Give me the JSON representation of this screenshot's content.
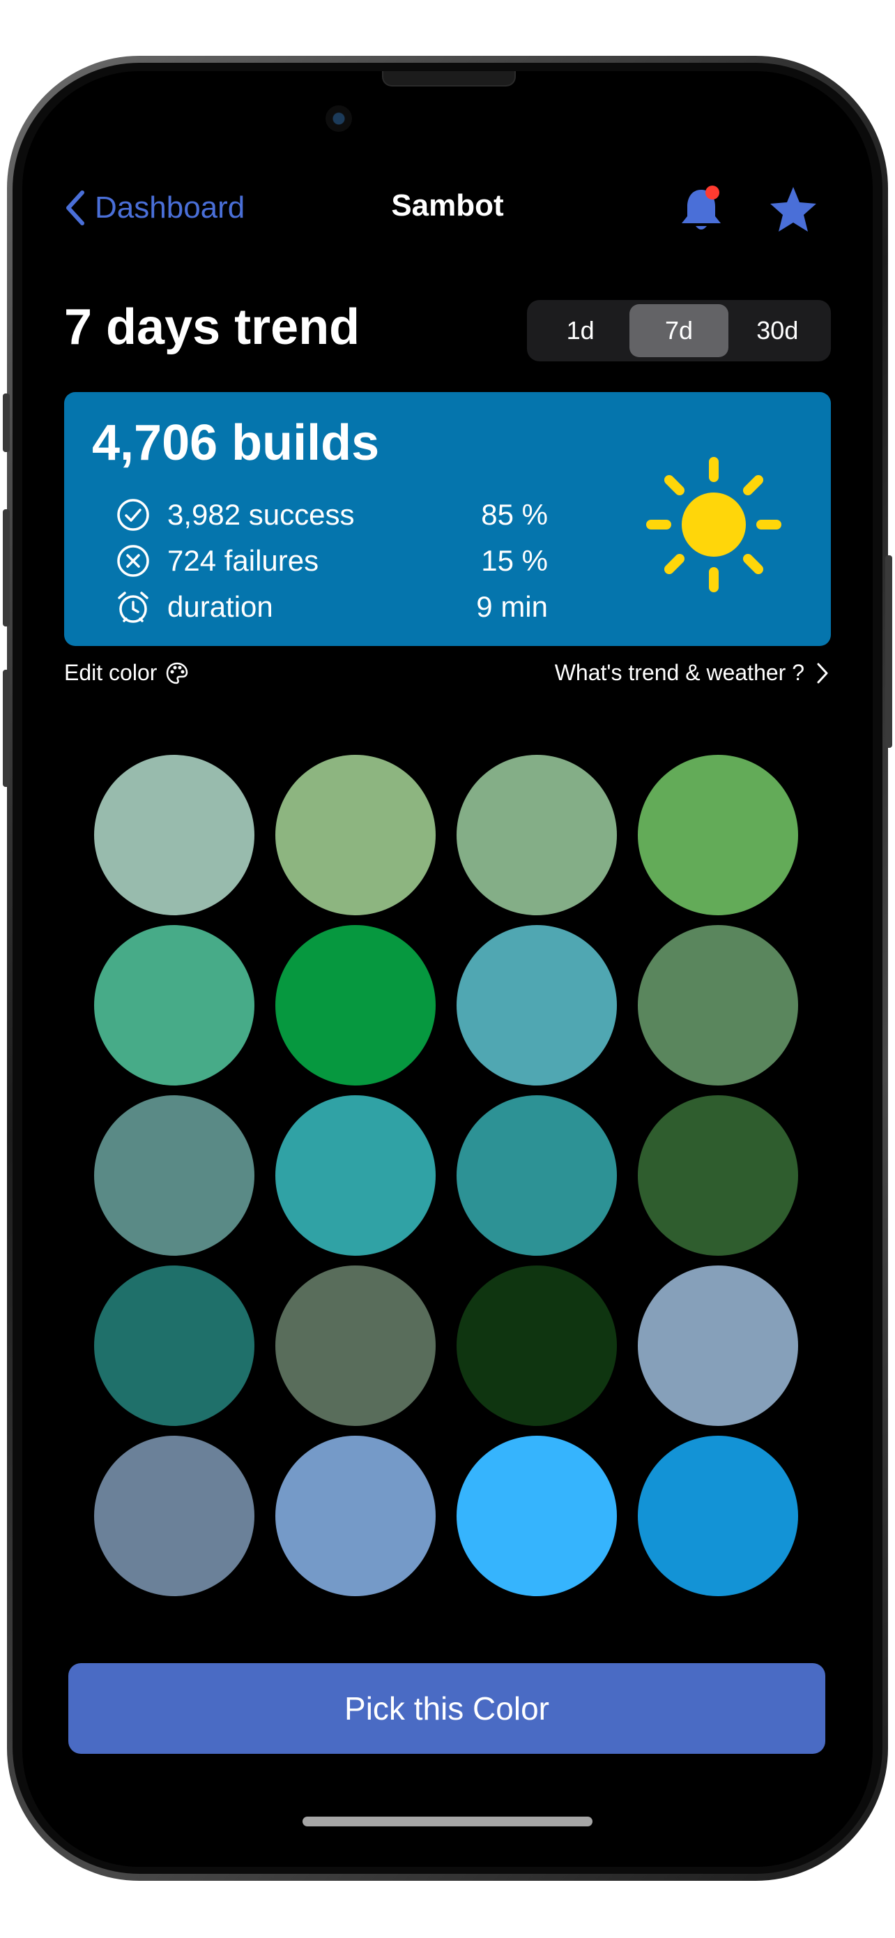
{
  "nav": {
    "back_label": "Dashboard",
    "title": "Sambot"
  },
  "trend": {
    "heading": "7 days trend",
    "periods": [
      "1d",
      "7d",
      "30d"
    ],
    "selected_period": "7d"
  },
  "summary": {
    "builds": "4,706 builds",
    "stats": [
      {
        "icon": "check-circle-icon",
        "label": "3,982 success",
        "value": "85 %"
      },
      {
        "icon": "x-circle-icon",
        "label": "724 failures",
        "value": "15 %"
      },
      {
        "icon": "alarm-clock-icon",
        "label": "duration",
        "value": "9 min"
      }
    ],
    "weather_icon": "sun-icon",
    "card_color": "#0575ad"
  },
  "links": {
    "edit_color": "Edit color",
    "trend_weather": "What's trend & weather ?"
  },
  "swatches": [
    "#98bbad",
    "#8db580",
    "#84ae87",
    "#63ab58",
    "#47ab88",
    "#06983f",
    "#50a7b2",
    "#5a865d",
    "#5a8a86",
    "#30a2a5",
    "#2d9295",
    "#2f5d2e",
    "#1f706a",
    "#596d5b",
    "#0f3510",
    "#86a0ba",
    "#6b8199",
    "#759ac8",
    "#36b4fd",
    "#1393d6"
  ],
  "actions": {
    "pick_label": "Pick this Color"
  },
  "colors": {
    "accent": "#4a6fd8",
    "button": "#4a6bc4",
    "sun": "#ffd60a",
    "notification_dot": "#ff3b30"
  }
}
